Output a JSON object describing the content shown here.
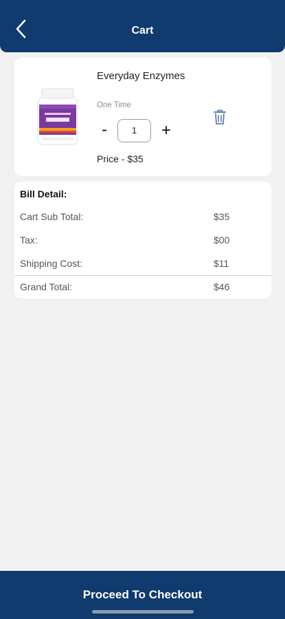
{
  "header": {
    "title": "Cart",
    "back_icon": "chevron-left-icon"
  },
  "cart_item": {
    "name": "Everyday Enzymes",
    "frequency": "One Time",
    "quantity": "1",
    "minus_label": "-",
    "plus_label": "+",
    "price": "Price - $35",
    "delete_icon": "trash-icon",
    "image": "product-bottle-image"
  },
  "bill": {
    "title": "Bill Detail:",
    "rows": [
      {
        "label": "Cart Sub Total:",
        "value": "$35"
      },
      {
        "label": "Tax:",
        "value": "$00"
      },
      {
        "label": "Shipping Cost:",
        "value": "$11"
      },
      {
        "label": "Grand Total:",
        "value": "$46"
      }
    ]
  },
  "footer": {
    "checkout_label": "Proceed To Checkout"
  },
  "colors": {
    "primary": "#0f3b6e",
    "background": "#f1f1f2",
    "card": "#ffffff",
    "trash_icon": "#5b7ea6"
  }
}
